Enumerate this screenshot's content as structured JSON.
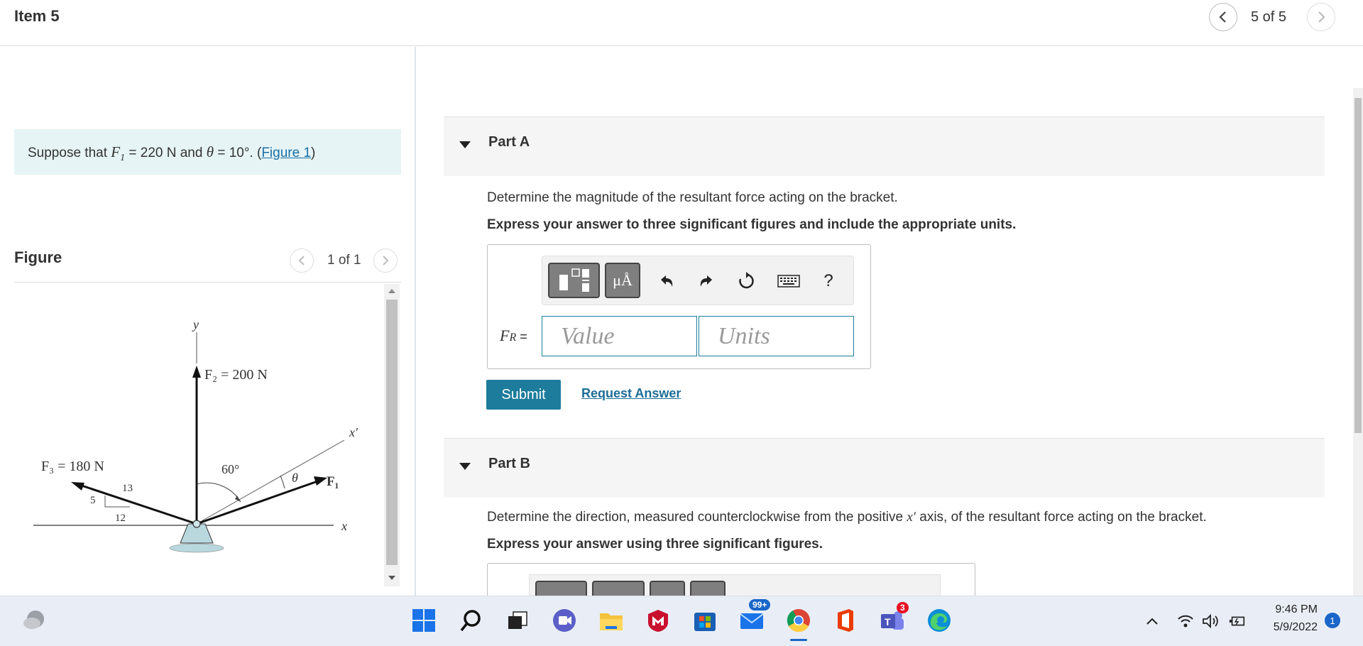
{
  "header": {
    "title": "Item 5",
    "position": "5 of 5"
  },
  "problem": {
    "prefix": "Suppose that ",
    "f1_symbol": "F",
    "f1_sub": "1",
    "f1_value": " = 220  N and ",
    "theta_symbol": "θ",
    "theta_value": " = 10°. (",
    "figure_link": "Figure 1",
    "suffix": ")"
  },
  "figure": {
    "title": "Figure",
    "count": "1 of 1",
    "labels": {
      "y": "y",
      "f2": "F₂ = 200 N",
      "x_prime": "x′",
      "f3": "F₃ = 180 N",
      "angle60": "60°",
      "theta": "θ",
      "f1": "F₁",
      "x": "x",
      "s13": "13",
      "s5": "5",
      "s12": "12"
    }
  },
  "part_a": {
    "label": "Part A",
    "question": "Determine the magnitude of the resultant force acting on the bracket.",
    "instruction": "Express your answer to three significant figures and include the appropriate units.",
    "var_symbol": "F",
    "var_sub": "R",
    "var_eq": " =",
    "value_placeholder": "Value",
    "units_placeholder": "Units",
    "units_btn": "μÅ",
    "help_btn": "?",
    "submit": "Submit",
    "request": "Request Answer"
  },
  "part_b": {
    "label": "Part B",
    "question_pre": "Determine the direction, measured counterclockwise from the positive ",
    "question_var": "x′",
    "question_post": " axis, of the resultant force acting on the bracket.",
    "instruction": "Express your answer using three significant figures."
  },
  "taskbar": {
    "mail_badge": "99+",
    "teams_badge": "3",
    "time": "9:46 PM",
    "date": "5/9/2022",
    "notif_count": "1"
  },
  "colors": {
    "accent": "#1d7c9c",
    "problem_bg": "#e6f4f5",
    "part_bar_bg": "#f5f5f5",
    "link": "#1a6fa8"
  }
}
